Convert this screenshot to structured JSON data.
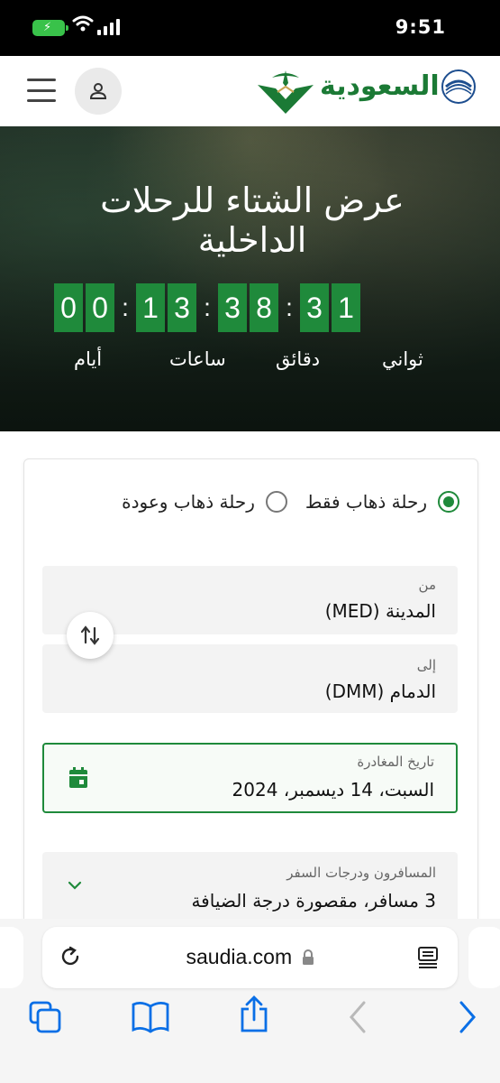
{
  "status_bar": {
    "time": "9:51"
  },
  "header": {
    "logo_text": "السعودية",
    "menu_icon": "hamburger-menu-icon",
    "profile_icon": "person-icon",
    "alliance_icon": "skyteam-icon"
  },
  "hero": {
    "title_line1": "عرض الشتاء للرحلات",
    "title_line2": "الداخلية",
    "countdown": {
      "days": [
        "0",
        "0"
      ],
      "hours": [
        "1",
        "3"
      ],
      "minutes": [
        "3",
        "8"
      ],
      "seconds": [
        "3",
        "1"
      ],
      "label_days": "أيام",
      "label_hours": "ساعات",
      "label_minutes": "دقائق",
      "label_seconds": "ثواني"
    }
  },
  "booking": {
    "trip_one_way": "رحلة ذهاب فقط",
    "trip_round": "رحلة ذهاب وعودة",
    "selected_trip": "one_way",
    "from_label": "من",
    "from_value": "المدينة (MED)",
    "to_label": "إلى",
    "to_value": "الدمام (DMM)",
    "date_label": "تاريخ المغادرة",
    "date_value": "السبت، 14 ديسمبر، 2024",
    "passengers_label": "المسافرون ودرجات السفر",
    "passengers_value": "3 مسافر، مقصورة درجة الضيافة"
  },
  "browser": {
    "url": "saudia.com",
    "icons": [
      "reload-icon",
      "lock-icon",
      "reader-icon",
      "tabs-icon",
      "bookmarks-icon",
      "share-icon",
      "back-icon",
      "forward-icon"
    ]
  },
  "colors": {
    "brand_green": "#1f8a3b",
    "status_bar": "#000000"
  }
}
